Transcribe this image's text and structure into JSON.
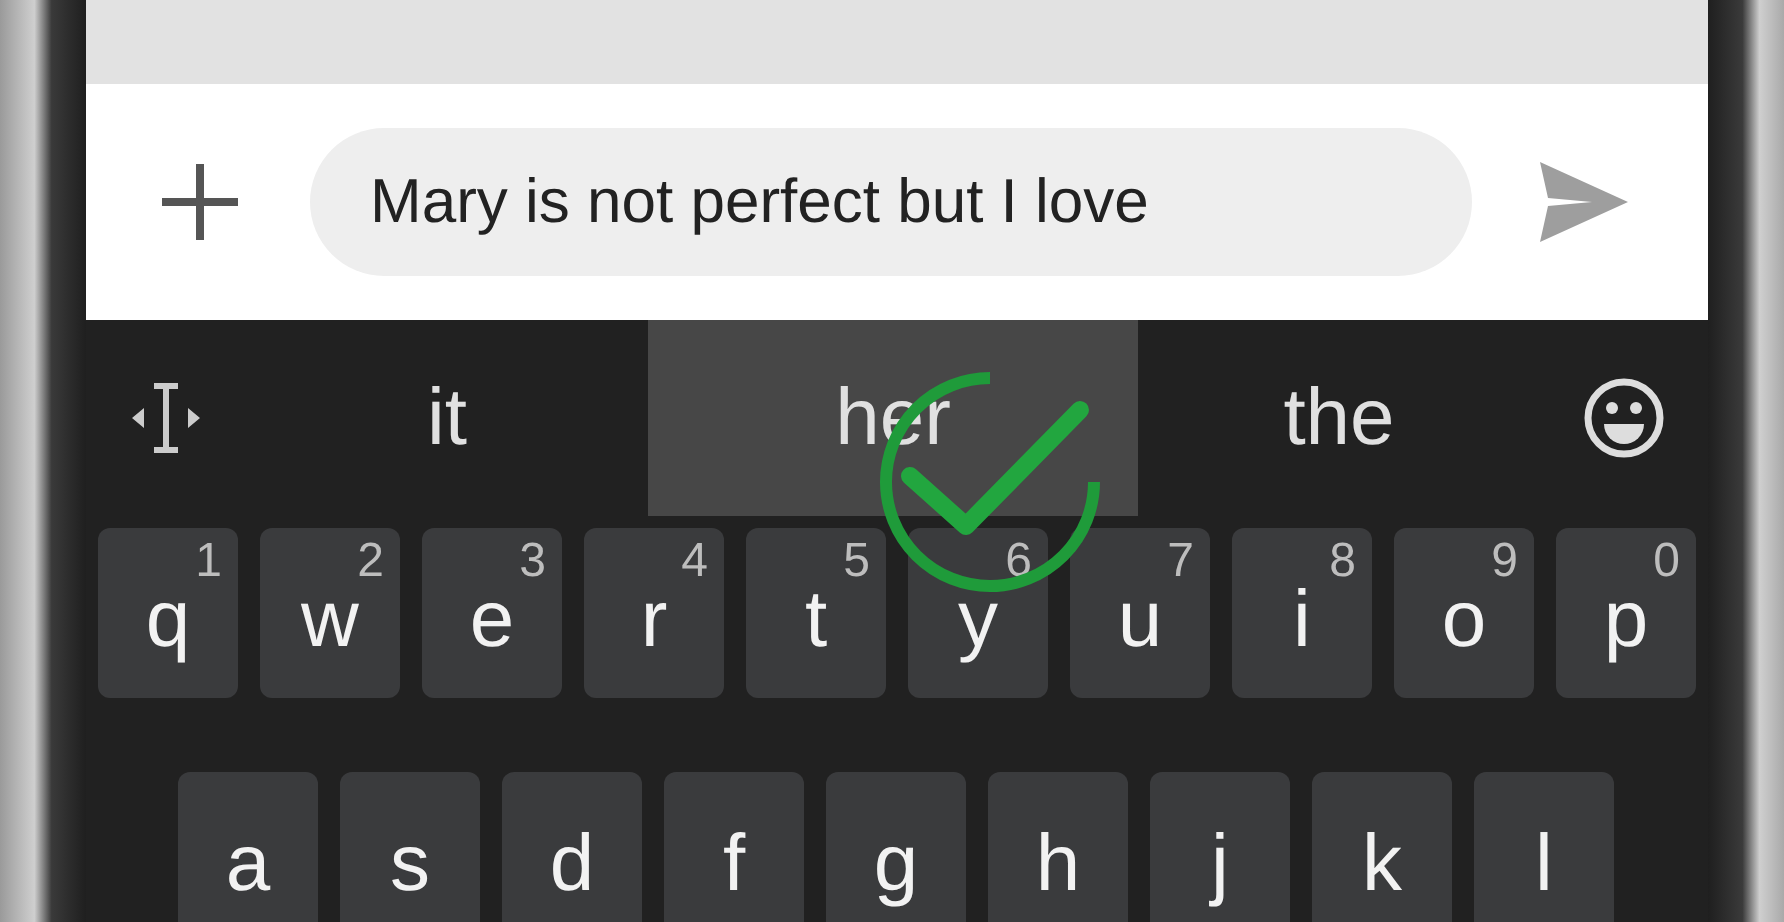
{
  "composer": {
    "value": "Mary is not perfect but I love"
  },
  "suggestions": [
    {
      "text": "it",
      "selected": false
    },
    {
      "text": "her",
      "selected": true
    },
    {
      "text": "the",
      "selected": false
    }
  ],
  "keyboard": {
    "rows": [
      [
        {
          "key": "q",
          "hint": "1"
        },
        {
          "key": "w",
          "hint": "2"
        },
        {
          "key": "e",
          "hint": "3"
        },
        {
          "key": "r",
          "hint": "4"
        },
        {
          "key": "t",
          "hint": "5"
        },
        {
          "key": "y",
          "hint": "6"
        },
        {
          "key": "u",
          "hint": "7"
        },
        {
          "key": "i",
          "hint": "8"
        },
        {
          "key": "o",
          "hint": "9"
        },
        {
          "key": "p",
          "hint": "0"
        }
      ],
      [
        {
          "key": "a"
        },
        {
          "key": "s"
        },
        {
          "key": "d"
        },
        {
          "key": "f"
        },
        {
          "key": "g"
        },
        {
          "key": "h"
        },
        {
          "key": "j"
        },
        {
          "key": "k"
        },
        {
          "key": "l"
        }
      ]
    ]
  }
}
